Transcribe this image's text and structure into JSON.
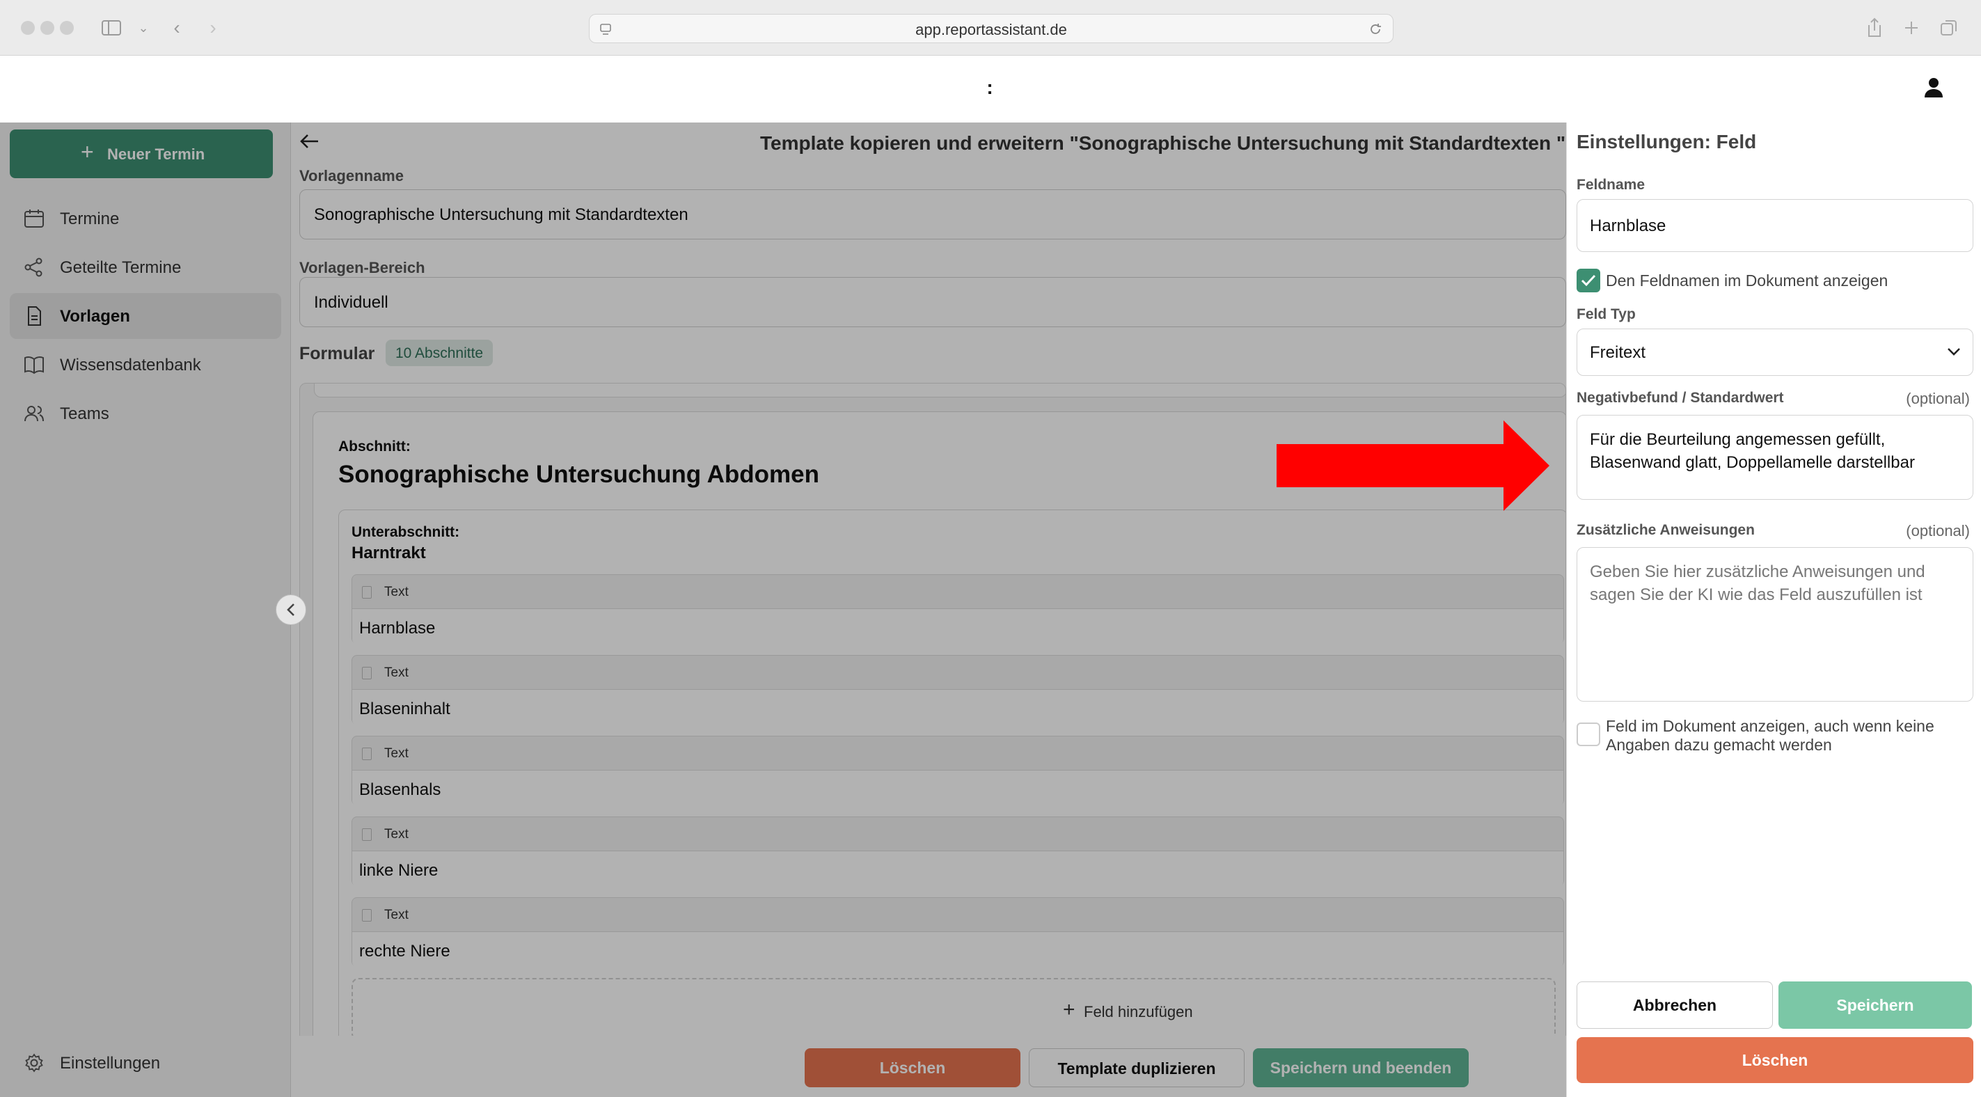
{
  "browser": {
    "url": "app.reportassistant.de"
  },
  "header": {
    "center_glyph": ":"
  },
  "sidebar": {
    "new_appointment_label": "Neuer Termin",
    "items": [
      {
        "label": "Termine",
        "icon": "calendar-icon",
        "active": false
      },
      {
        "label": "Geteilte Termine",
        "icon": "share-icon",
        "active": false
      },
      {
        "label": "Vorlagen",
        "icon": "document-icon",
        "active": true
      },
      {
        "label": "Wissensdatenbank",
        "icon": "book-icon",
        "active": false
      },
      {
        "label": "Teams",
        "icon": "users-icon",
        "active": false
      }
    ],
    "settings_label": "Einstellungen"
  },
  "main": {
    "title": "Template kopieren und erweitern \"Sonographische Untersuchung mit Standardtexten \"",
    "template_name_label": "Vorlagenname",
    "template_name_value": "Sonographische Untersuchung mit Standardtexten",
    "template_area_label": "Vorlagen-Bereich",
    "template_area_value": "Individuell",
    "form_label": "Formular",
    "sections_badge": "10 Abschnitte",
    "section_kicker": "Abschnitt:",
    "section_title": "Sonographische Untersuchung Abdomen",
    "subsection_kicker": "Unterabschnitt:",
    "subsection_title": "Harntrakt",
    "fields": [
      {
        "type": "Text",
        "name": "Harnblase"
      },
      {
        "type": "Text",
        "name": "Blaseninhalt"
      },
      {
        "type": "Text",
        "name": "Blasenhals"
      },
      {
        "type": "Text",
        "name": "linke Niere"
      },
      {
        "type": "Text",
        "name": "rechte Niere"
      }
    ],
    "add_field_label": "Feld hinzufügen",
    "delete_label": "Löschen",
    "duplicate_label": "Template duplizieren",
    "save_and_close_label": "Speichern und beenden"
  },
  "panel": {
    "title": "Einstellungen: Feld",
    "field_name_label": "Feldname",
    "field_name_value": "Harnblase",
    "show_name_checkbox_label": "Den Feldnamen im Dokument anzeigen",
    "show_name_checked": true,
    "field_type_label": "Feld Typ",
    "field_type_value": "Freitext",
    "default_label": "Negativbefund / Standardwert",
    "optional_text": "(optional)",
    "default_value": "Für die Beurteilung angemessen gefüllt, Blasenwand glatt, Doppellamelle darstellbar",
    "instructions_label": "Zusätzliche Anweisungen",
    "instructions_placeholder": "Geben Sie hier zusätzliche Anweisungen und sagen Sie der KI wie das Feld auszufüllen ist",
    "show_always_checkbox_label": "Feld im Dokument anzeigen, auch wenn keine Angaben dazu gemacht werden",
    "show_always_checked": false,
    "cancel_label": "Abbrechen",
    "save_label": "Speichern",
    "delete_label": "Löschen"
  },
  "colors": {
    "accent_green": "#3d8f72",
    "delete_orange": "#e5734f",
    "annotation_arrow": "#ff0000"
  }
}
